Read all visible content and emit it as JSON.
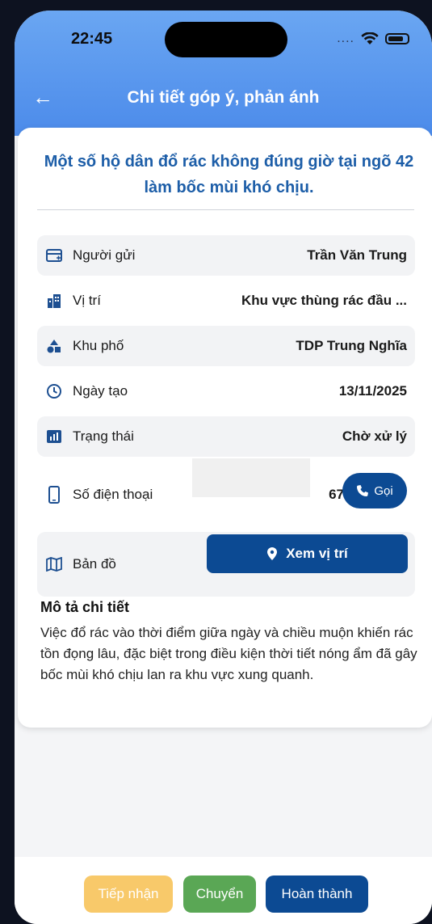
{
  "status_bar": {
    "time": "22:45",
    "signal": "...."
  },
  "nav": {
    "title": "Chi tiết góp ý, phản ánh"
  },
  "report": {
    "title": "Một số hộ dân đổ rác không đúng giờ tại ngõ 42 làm bốc mùi khó chịu.",
    "fields": [
      {
        "icon": "id-card-icon",
        "label": "Người gửi",
        "value": "Trần Văn Trung"
      },
      {
        "icon": "building-icon",
        "label": "Vị trí",
        "value": "Khu vực thùng rác đầu ..."
      },
      {
        "icon": "shapes-icon",
        "label": "Khu phố",
        "value": "TDP Trung Nghĩa"
      },
      {
        "icon": "clock-icon",
        "label": "Ngày tạo",
        "value": "13/11/2025"
      },
      {
        "icon": "chart-icon",
        "label": "Trạng thái",
        "value": "Chờ xử lý"
      }
    ],
    "phone": {
      "label": "Số điện thoại",
      "value": "67",
      "call_label": "Gọi"
    },
    "map": {
      "label": "Bản đồ",
      "button_label": "Xem vị trí"
    },
    "description_heading": "Mô tả chi tiết",
    "description": "Việc đổ rác vào thời điểm giữa ngày và chiều muộn khiến rác tồn đọng lâu, đặc biệt trong điều kiện thời tiết nóng ẩm đã gây bốc mùi khó chịu lan ra khu vực xung quanh."
  },
  "actions": {
    "receive": "Tiếp nhận",
    "forward": "Chuyển",
    "done": "Hoàn thành"
  },
  "colors": {
    "primary": "#0c4a93",
    "title": "#1d5ea8",
    "receive": "#f8c96a",
    "forward": "#5aa755"
  }
}
